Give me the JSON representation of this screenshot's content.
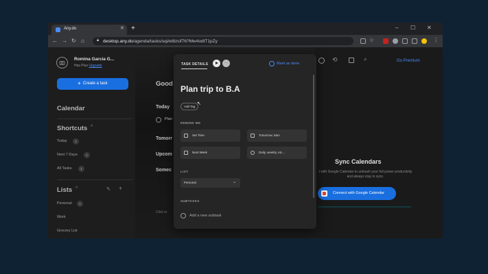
{
  "browser": {
    "tab_title": "Any.do",
    "url_host": "desktop.any.do",
    "url_path": "/agenda/tasks/sqi/et8zsif76?Mw4odtT1pZy"
  },
  "sidebar": {
    "user_name": "Romina García G...",
    "plan_text": "Has Plus",
    "upgrade_label": "Upgrade",
    "create_task_label": "Create a task",
    "calendar_label": "Calendar",
    "shortcuts_label": "Shortcuts",
    "shortcuts": [
      {
        "label": "Today",
        "count": "1"
      },
      {
        "label": "Next 7 Days",
        "count": "1"
      },
      {
        "label": "All Tasks",
        "count": "1"
      }
    ],
    "lists_label": "Lists",
    "lists": [
      {
        "label": "Personal",
        "count": "1"
      },
      {
        "label": "Work",
        "count": ""
      },
      {
        "label": "Grocery List",
        "count": ""
      }
    ]
  },
  "main": {
    "greeting": "Good",
    "today_label": "Today",
    "task_fragment": "Plan",
    "tomorrow_label": "Tomorr",
    "upcoming_label": "Upcom",
    "someday_label": "Somec",
    "add_task_fragment": "Click to"
  },
  "right_panel": {
    "go_premium": "Go Premium",
    "sync_title": "Sync Calendars",
    "sync_desc": "t with Google Calendar to unleash your full power productivity and always stay in sync.",
    "connect_label": "Connect with Google Calendar"
  },
  "modal": {
    "tab_label": "TASK DETAILS",
    "mark_done_label": "Mark as done",
    "title": "Plan trip to B.A",
    "add_tag_label": "Add Tag",
    "remind_me_label": "REMIND ME",
    "remind_options": [
      "Set Time",
      "Tomorrow, 9am",
      "Next Week",
      "Daily, weekly, etc..."
    ],
    "list_label": "LIST",
    "list_value": "Personal",
    "subtasks_label": "SUBTASKS",
    "add_subtask_label": "Add a new subtask"
  },
  "colors": {
    "accent": "#1a6fe0",
    "link": "#4a8cf7",
    "page_bg": "#0f2233"
  }
}
